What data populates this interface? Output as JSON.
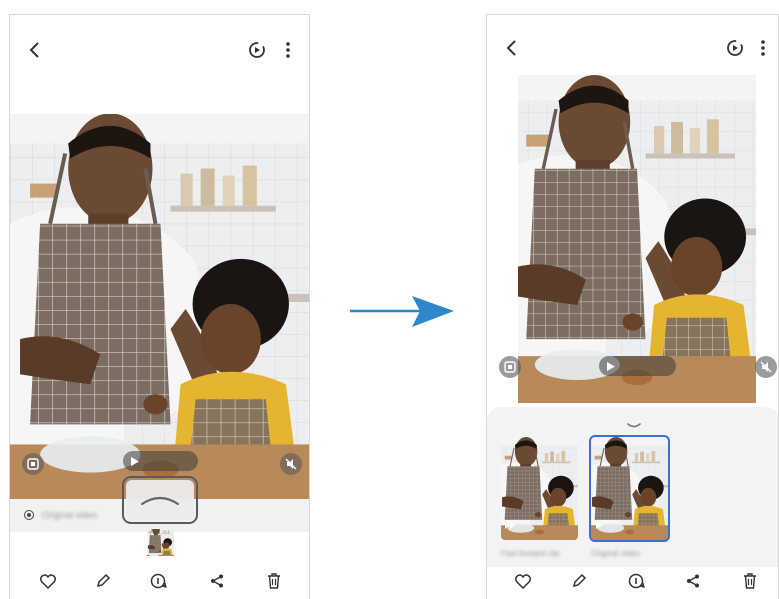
{
  "left_screen": {
    "mode_label": "Original video",
    "play_label": ""
  },
  "right_screen": {
    "play_label": "",
    "thumbnails": [
      {
        "caption": "Fast forward clip",
        "selected": false
      },
      {
        "caption": "Original video",
        "selected": true
      }
    ]
  },
  "icons": {
    "back": "chevron-left-icon",
    "motion": "motion-photo-icon",
    "more": "more-vertical-icon",
    "favorite": "heart-icon",
    "edit": "pencil-icon",
    "info": "info-icon",
    "share": "share-icon",
    "delete": "trash-icon",
    "arrow": "arrow-right-icon"
  },
  "colors": {
    "arrow": "#2f86c8",
    "selection": "#3a6fd8",
    "apron": "#7d6f63",
    "shirt_child": "#e6b530"
  }
}
